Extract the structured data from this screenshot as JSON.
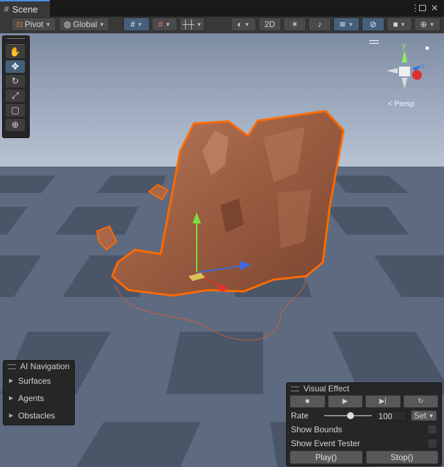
{
  "tab": {
    "title": "Scene"
  },
  "toolbar": {
    "pivot_label": "Pivot",
    "global_label": "Global",
    "mode_2d_label": "2D"
  },
  "gizmo": {
    "persp_label": "Persp",
    "y_label": "y",
    "z_label": "z"
  },
  "ai_navigation": {
    "title": "AI Navigation",
    "items": [
      "Surfaces",
      "Agents",
      "Obstacles"
    ]
  },
  "visual_effect": {
    "title": "Visual Effect",
    "rate_label": "Rate",
    "rate_value": "100",
    "set_label": "Set",
    "show_bounds_label": "Show Bounds",
    "show_event_tester_label": "Show Event Tester",
    "play_label": "Play()",
    "stop_label": "Stop()"
  },
  "colors": {
    "accent": "#4a90e2",
    "selection_outline": "#ff6a00",
    "rock": "#a9674a",
    "sky": "#aab5c8"
  }
}
